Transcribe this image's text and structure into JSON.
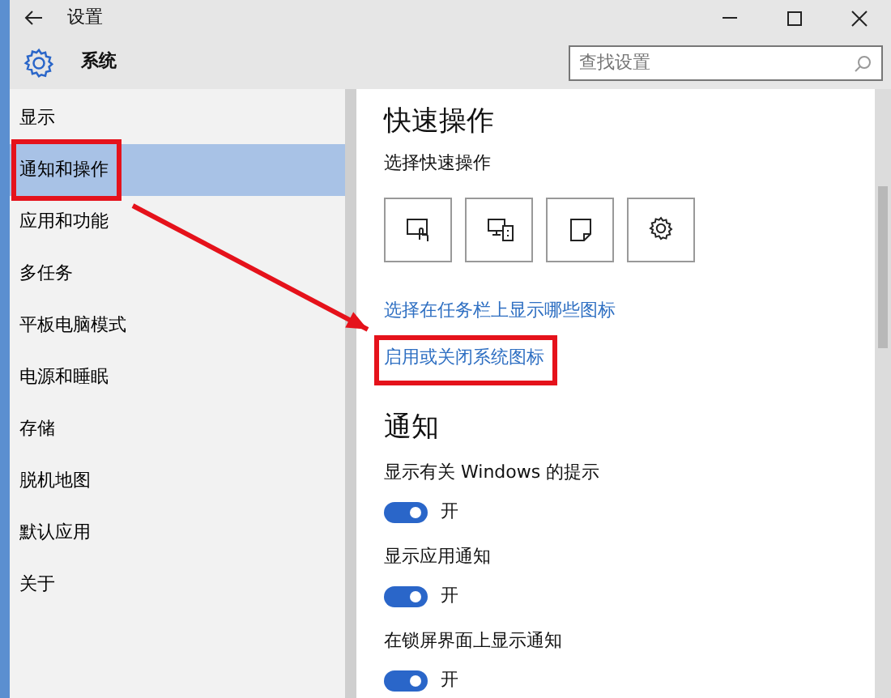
{
  "window": {
    "title": "设置"
  },
  "header": {
    "title": "系统",
    "search": {
      "placeholder": "查找设置"
    }
  },
  "sidebar": {
    "items": [
      {
        "label": "显示",
        "selected": false,
        "highlighted": false
      },
      {
        "label": "通知和操作",
        "selected": true,
        "highlighted": true
      },
      {
        "label": "应用和功能",
        "selected": false,
        "highlighted": false
      },
      {
        "label": "多任务",
        "selected": false,
        "highlighted": false
      },
      {
        "label": "平板电脑模式",
        "selected": false,
        "highlighted": false
      },
      {
        "label": "电源和睡眠",
        "selected": false,
        "highlighted": false
      },
      {
        "label": "存储",
        "selected": false,
        "highlighted": false
      },
      {
        "label": "脱机地图",
        "selected": false,
        "highlighted": false
      },
      {
        "label": "默认应用",
        "selected": false,
        "highlighted": false
      },
      {
        "label": "关于",
        "selected": false,
        "highlighted": false
      }
    ]
  },
  "quick_actions": {
    "heading": "快速操作",
    "subheading": "选择快速操作",
    "tiles": [
      {
        "kind": "tablet"
      },
      {
        "kind": "project"
      },
      {
        "kind": "note"
      },
      {
        "kind": "settings"
      }
    ],
    "links": [
      {
        "label": "选择在任务栏上显示哪些图标",
        "highlighted": false
      },
      {
        "label": "启用或关闭系统图标",
        "highlighted": true
      }
    ]
  },
  "notifications": {
    "heading": "通知",
    "settings": [
      {
        "label": "显示有关 Windows 的提示",
        "on": true,
        "state": "开"
      },
      {
        "label": "显示应用通知",
        "on": true,
        "state": "开"
      },
      {
        "label": "在锁屏界面上显示通知",
        "on": true,
        "state": "开"
      }
    ]
  }
}
